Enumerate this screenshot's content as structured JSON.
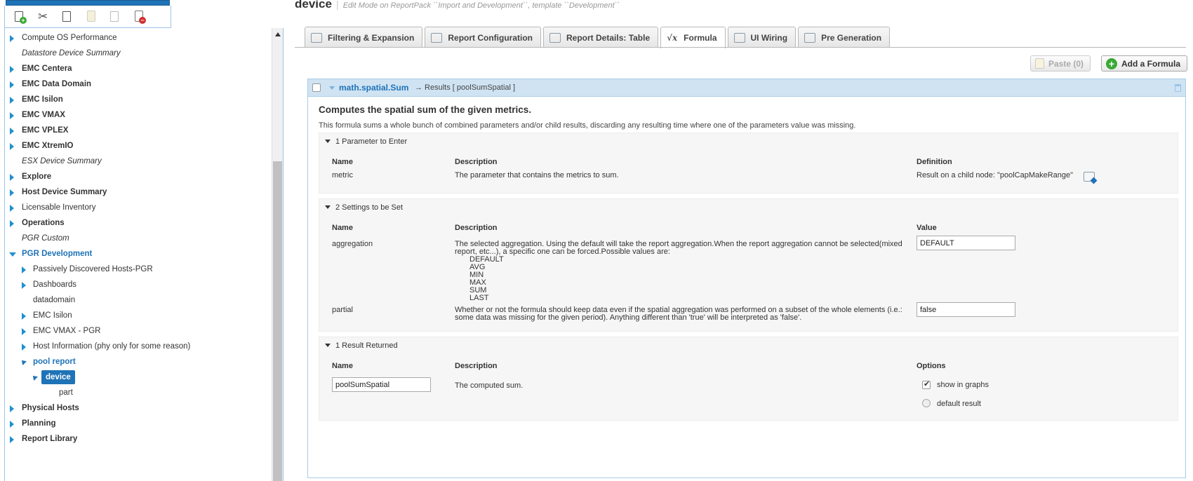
{
  "toolbar": {
    "buttons": [
      "add-node-icon",
      "cut-icon",
      "copy-icon",
      "paste-icon",
      "paste-disabled-icon",
      "delete-node-icon"
    ]
  },
  "tree": {
    "items": [
      {
        "label": "Compute OS Performance",
        "style": "normal"
      },
      {
        "label": "Datastore Device Summary",
        "style": "italic"
      },
      {
        "label": "EMC Centera",
        "style": "bold"
      },
      {
        "label": "EMC Data Domain",
        "style": "bold"
      },
      {
        "label": "EMC Isilon",
        "style": "bold"
      },
      {
        "label": "EMC VMAX",
        "style": "bold"
      },
      {
        "label": "EMC VPLEX",
        "style": "bold"
      },
      {
        "label": "EMC XtremIO",
        "style": "bold"
      },
      {
        "label": "ESX Device Summary",
        "style": "italic"
      },
      {
        "label": "Explore",
        "style": "bold"
      },
      {
        "label": "Host Device Summary",
        "style": "bold"
      },
      {
        "label": "Licensable Inventory",
        "style": "normal"
      },
      {
        "label": "Operations",
        "style": "bold"
      },
      {
        "label": "PGR Custom",
        "style": "italic"
      },
      {
        "label": "PGR Development",
        "style": "bold-blue"
      },
      {
        "label": "Passively Discovered Hosts-PGR",
        "style": "normal"
      },
      {
        "label": "Dashboards",
        "style": "normal"
      },
      {
        "label": "datadomain",
        "style": "normal"
      },
      {
        "label": "EMC Isilon",
        "style": "normal"
      },
      {
        "label": "EMC VMAX - PGR",
        "style": "normal"
      },
      {
        "label": "Host Information (phy only for some reason)",
        "style": "normal"
      },
      {
        "label": "pool report",
        "style": "bold-blue"
      },
      {
        "label": "device",
        "style": "selected"
      },
      {
        "label": "part",
        "style": "normal"
      },
      {
        "label": "Physical Hosts",
        "style": "bold"
      },
      {
        "label": "Planning",
        "style": "bold"
      },
      {
        "label": "Report Library",
        "style": "bold"
      }
    ]
  },
  "header": {
    "title": "device",
    "separator": "|",
    "subtitle": "Edit Mode on ReportPack ``Import and Development``, template ``Development``"
  },
  "tabs": [
    {
      "label": "Filtering & Expansion",
      "icon": "filter-tree-icon"
    },
    {
      "label": "Report Configuration",
      "icon": "report-config-icon"
    },
    {
      "label": "Report Details: Table",
      "icon": "table-details-icon"
    },
    {
      "label": "Formula",
      "icon": "formula-icon",
      "active": true
    },
    {
      "label": "UI Wiring",
      "icon": "ui-wiring-icon"
    },
    {
      "label": "Pre Generation",
      "icon": "calendar-icon"
    }
  ],
  "actions": {
    "paste_label": "Paste (0)",
    "add_formula_label": "Add a Formula"
  },
  "formula": {
    "name": "math.spatial.Sum",
    "results_text": "→ Results [ poolSumSpatial ]",
    "title": "Computes the spatial sum of the given metrics.",
    "description": "This formula sums a whole bunch of combined parameters and/or child results, discarding any resulting time where one of the parameters value was missing.",
    "parameters": {
      "header": "1 Parameter to Enter",
      "col_name": "Name",
      "col_desc": "Description",
      "col_def": "Definition",
      "rows": [
        {
          "name": "metric",
          "desc": "The parameter that contains the metrics to sum.",
          "definition": "Result on a child node: \"poolCapMakeRange\""
        }
      ]
    },
    "settings": {
      "header": "2 Settings to be Set",
      "col_name": "Name",
      "col_desc": "Description",
      "col_value": "Value",
      "aggregation": {
        "name": "aggregation",
        "desc": "The selected aggregation. Using the default will take the report aggregation.When the report aggregation cannot be selected(mixed report, etc...), a specific one can be forced.Possible values are:",
        "options": [
          "DEFAULT",
          "AVG",
          "MIN",
          "MAX",
          "SUM",
          "LAST"
        ],
        "value": "DEFAULT"
      },
      "partial": {
        "name": "partial",
        "desc": "Whether or not the formula should keep data even if the spatial aggregation was performed on a subset of the whole elements (i.e.: some data was missing for the given period). Anything different than 'true' will be interpreted as 'false'.",
        "value": "false"
      }
    },
    "results": {
      "header": "1 Result Returned",
      "col_name": "Name",
      "col_desc": "Description",
      "col_options": "Options",
      "row": {
        "name": "poolSumSpatial",
        "desc": "The computed sum.",
        "opt_show": "show in graphs",
        "opt_default": "default result"
      }
    }
  }
}
